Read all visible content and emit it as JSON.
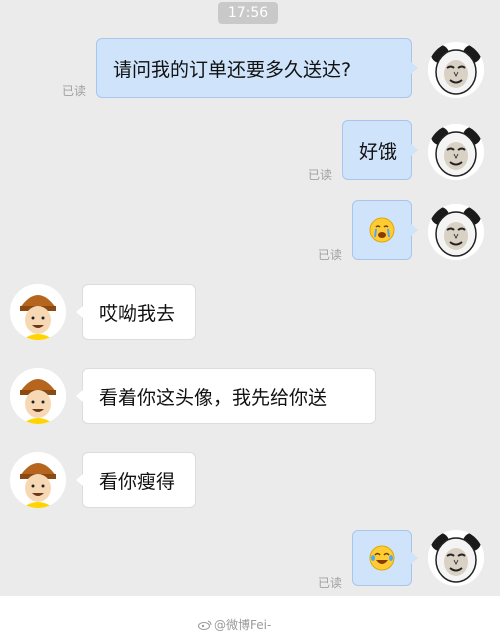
{
  "status": {
    "time": "17:56"
  },
  "read_label": "已读",
  "messages": [
    {
      "side": "sent",
      "text": "请问我的订单还要多久送达?"
    },
    {
      "side": "sent",
      "text": "好饿"
    },
    {
      "side": "sent",
      "emoji": "crying-face-emoji"
    },
    {
      "side": "received",
      "text": "哎呦我去"
    },
    {
      "side": "received",
      "text": "看着你这头像，我先给你送"
    },
    {
      "side": "received",
      "text": "看你瘦得"
    },
    {
      "side": "sent",
      "emoji": "tears-of-joy-emoji"
    }
  ],
  "watermark": {
    "text": "@微博Fei-"
  },
  "colors": {
    "sent_bubble": "#cfe3fb",
    "received_bubble": "#ffffff",
    "background": "#ebebeb"
  }
}
